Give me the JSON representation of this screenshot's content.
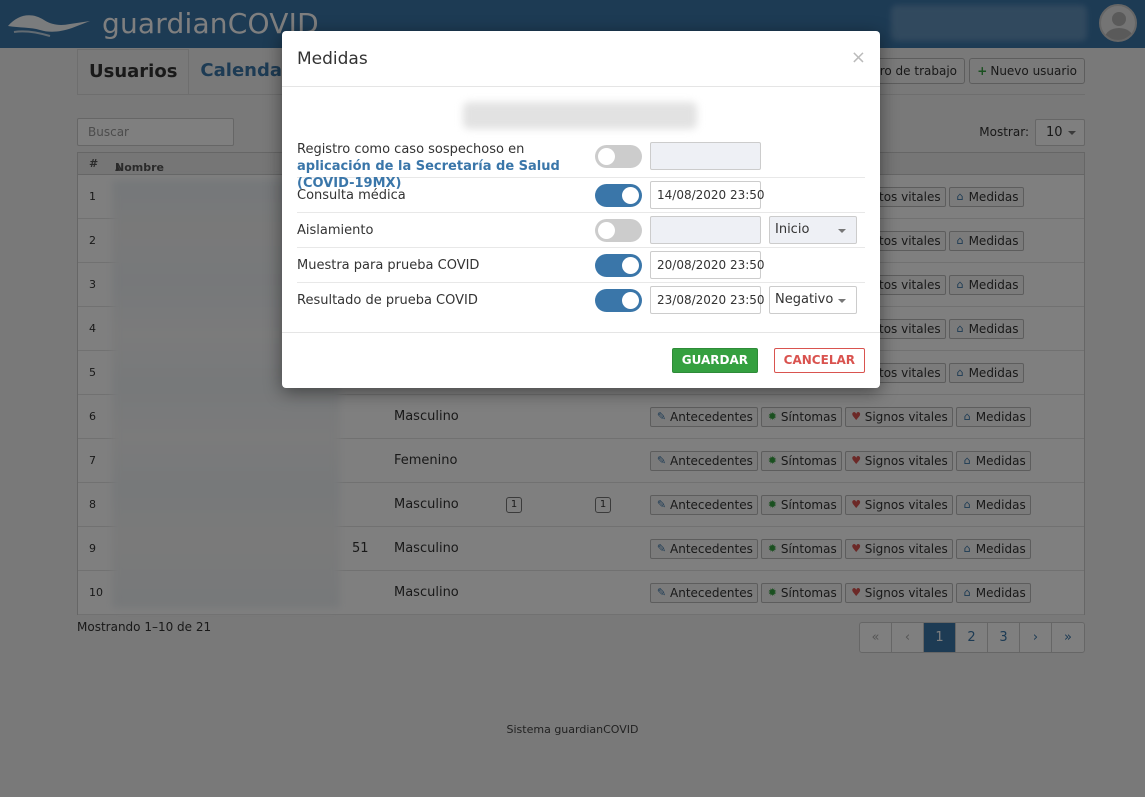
{
  "header": {
    "brand": "guardianCOVID"
  },
  "tabs": [
    {
      "label": "Usuarios"
    },
    {
      "label": "Calendario"
    }
  ],
  "toolbar": {
    "workplace_label": "tro de trabajo",
    "new_user_label": "Nuevo usuario"
  },
  "search": {
    "placeholder": "Buscar"
  },
  "show": {
    "label": "Mostrar:",
    "value": "10"
  },
  "table": {
    "headers": {
      "num": "#",
      "name": "Nombre"
    },
    "rows": [
      {
        "num": "1",
        "age": "",
        "sex": ""
      },
      {
        "num": "2",
        "age": "",
        "sex": ""
      },
      {
        "num": "3",
        "age": "",
        "sex": ""
      },
      {
        "num": "4",
        "age": "",
        "sex": ""
      },
      {
        "num": "5",
        "age": "",
        "sex": ""
      },
      {
        "num": "6",
        "age": "",
        "sex": "Masculino"
      },
      {
        "num": "7",
        "age": "",
        "sex": "Femenino"
      },
      {
        "num": "8",
        "age": "",
        "sex": "Masculino",
        "badge1": "1",
        "badge2": "1"
      },
      {
        "num": "9",
        "age": "51",
        "sex": "Masculino"
      },
      {
        "num": "10",
        "age": "",
        "sex": "Masculino"
      }
    ],
    "actions": {
      "antecedentes": "Antecedentes",
      "sintomas": "Síntomas",
      "signos": "Signos vitales",
      "medidas": "Medidas",
      "partial_signos": "tos vitales"
    }
  },
  "footer": {
    "count": "Mostrando 1–10 de 21",
    "system": "Sistema guardianCOVID"
  },
  "pagination": {
    "first": "«",
    "prev": "‹",
    "pages": [
      "1",
      "2",
      "3"
    ],
    "next": "›",
    "last": "»",
    "active": "1"
  },
  "modal": {
    "title": "Medidas",
    "close": "×",
    "rows": [
      {
        "label_prefix": "Registro como caso sospechoso en ",
        "label_link": "aplicación de la Secretaría de Salud (COVID-19MX)",
        "toggle": false,
        "date": ""
      },
      {
        "label": "Consulta médica",
        "toggle": true,
        "date": "14/08/2020 23:50"
      },
      {
        "label": "Aislamiento",
        "toggle": false,
        "date": "",
        "select": "Inicio"
      },
      {
        "label": "Muestra para prueba COVID",
        "toggle": true,
        "date": "20/08/2020 23:50"
      },
      {
        "label": "Resultado de prueba COVID",
        "toggle": true,
        "date": "23/08/2020 23:50",
        "select": "Negativo"
      }
    ],
    "save": "GUARDAR",
    "cancel": "CANCELAR"
  },
  "colors": {
    "primary": "#3a76a9",
    "success": "#35a040",
    "danger": "#d9534f"
  }
}
